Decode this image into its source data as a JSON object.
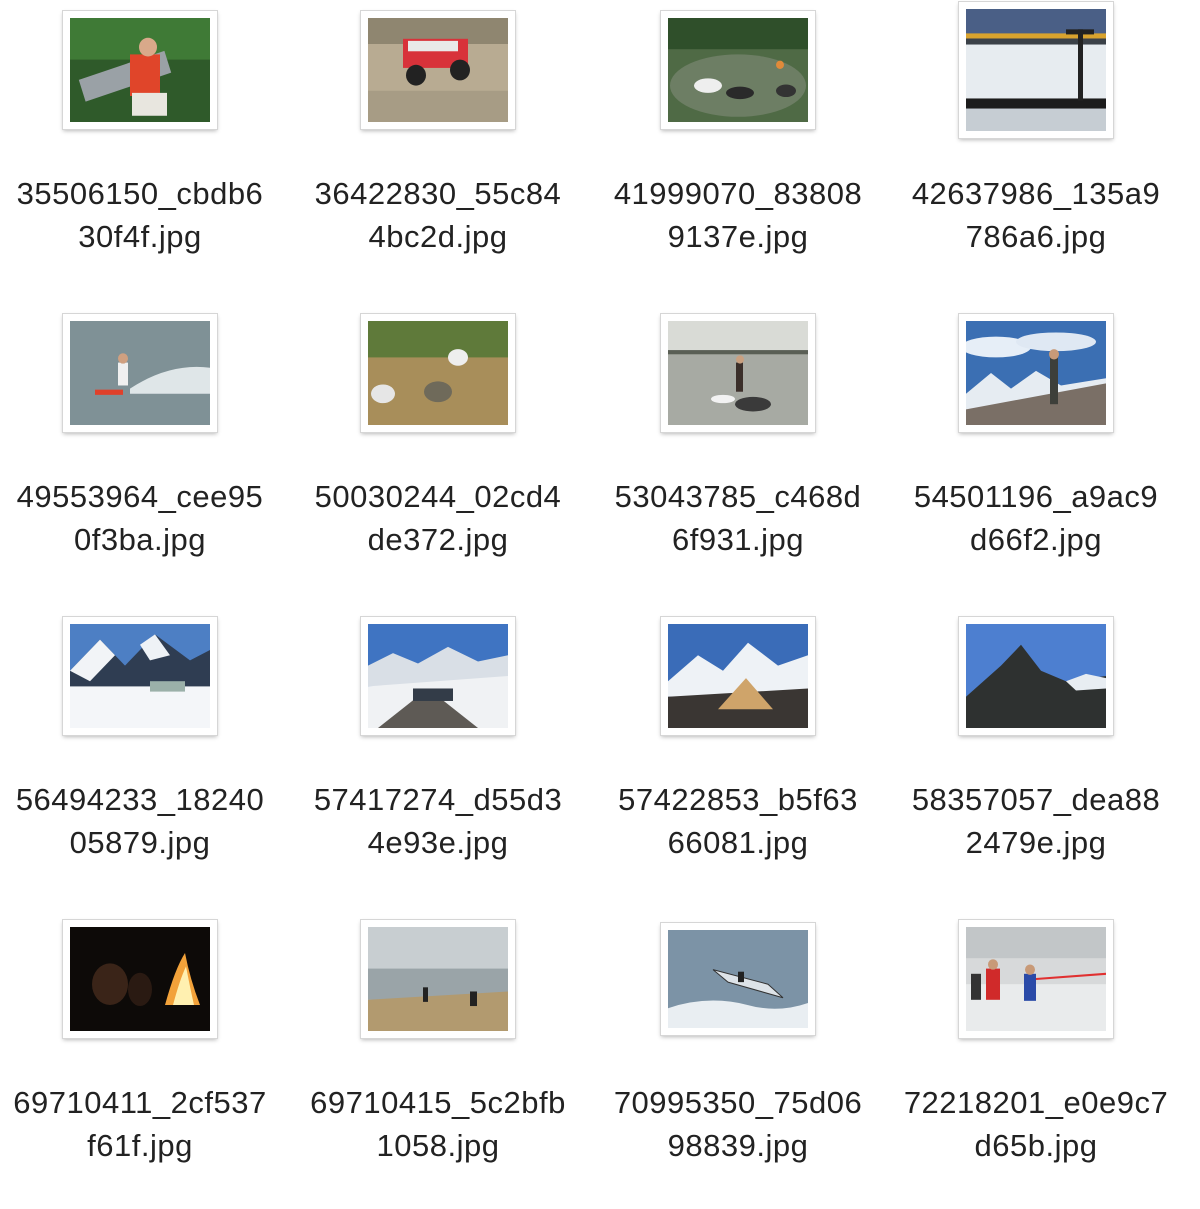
{
  "files": [
    {
      "line1": "35506150_cbdb6",
      "line2": "30f4f.jpg",
      "icon": "photo-boy-on-bench"
    },
    {
      "line1": "36422830_55c84",
      "line2": "4bc2d.jpg",
      "icon": "photo-red-jeep-rocks"
    },
    {
      "line1": "41999070_83808",
      "line2": "9137e.jpg",
      "icon": "photo-dogs-in-pond"
    },
    {
      "line1": "42637986_135a9",
      "line2": "786a6.jpg",
      "icon": "photo-dock-sunset-lake"
    },
    {
      "line1": "49553964_cee95",
      "line2": "0f3ba.jpg",
      "icon": "photo-water-skier"
    },
    {
      "line1": "50030244_02cd4",
      "line2": "de372.jpg",
      "icon": "photo-grass-rocks"
    },
    {
      "line1": "53043785_c468d",
      "line2": "6f931.jpg",
      "icon": "photo-man-lake-dog"
    },
    {
      "line1": "54501196_a9ac9",
      "line2": "d66f2.jpg",
      "icon": "photo-hiker-mountains"
    },
    {
      "line1": "56494233_18240",
      "line2": "05879.jpg",
      "icon": "photo-snowy-peaks"
    },
    {
      "line1": "57417274_d55d3",
      "line2": "4e93e.jpg",
      "icon": "photo-group-summit"
    },
    {
      "line1": "57422853_b5f63",
      "line2": "66081.jpg",
      "icon": "photo-tent-mountain"
    },
    {
      "line1": "58357057_dea88",
      "line2": "2479e.jpg",
      "icon": "photo-peak-silhouette"
    },
    {
      "line1": "69710411_2cf537",
      "line2": "f61f.jpg",
      "icon": "photo-campfire-night"
    },
    {
      "line1": "69710415_5c2bfb",
      "line2": "1058.jpg",
      "icon": "photo-cliff-fog"
    },
    {
      "line1": "70995350_75d06",
      "line2": "98839.jpg",
      "icon": "photo-windsurfer-jump"
    },
    {
      "line1": "72218201_e0e9c7",
      "line2": "d65b.jpg",
      "icon": "photo-runners-snow"
    }
  ]
}
